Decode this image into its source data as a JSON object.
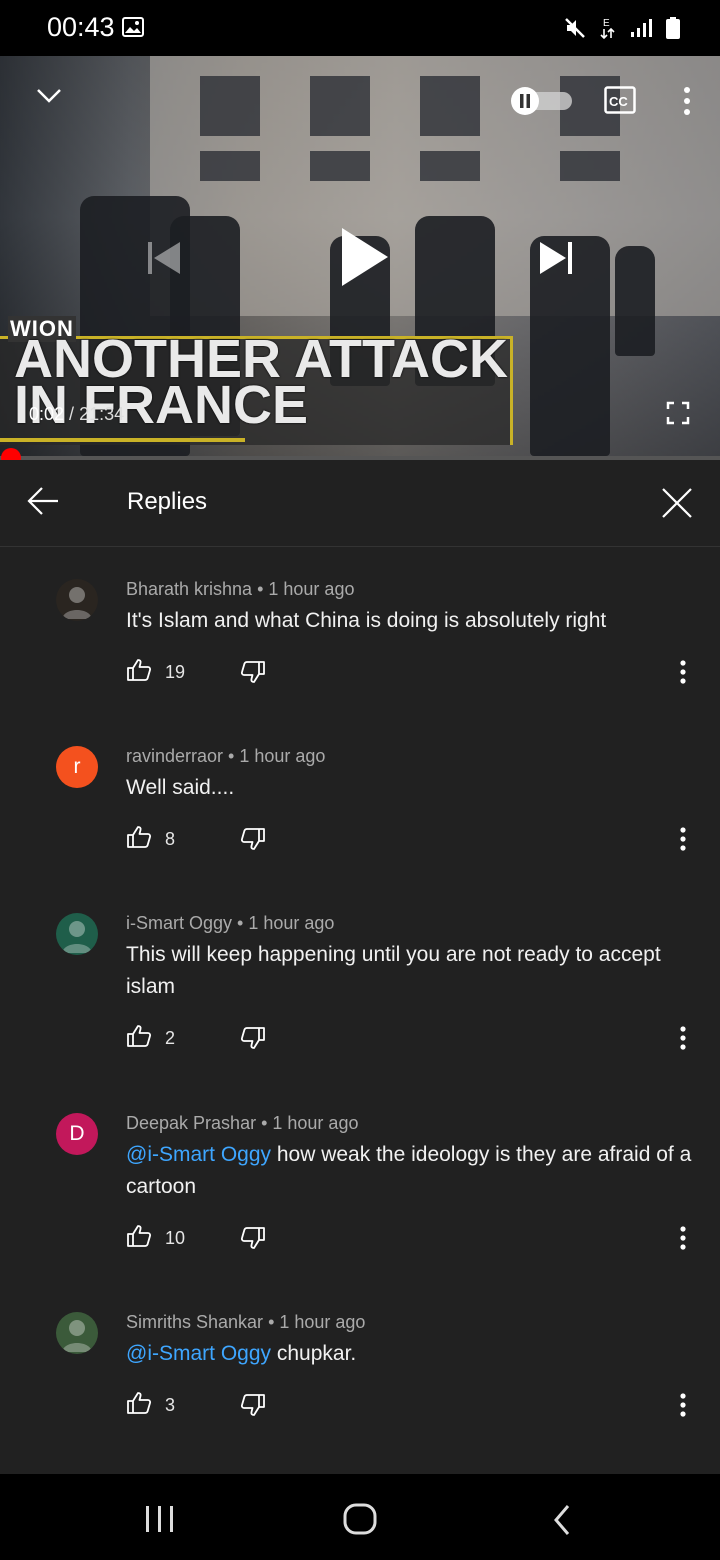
{
  "status_bar": {
    "time": "00:43"
  },
  "player": {
    "channel_logo": "WION",
    "headline_line1": "ANOTHER ATTACK",
    "headline_line2": "IN FRANCE",
    "current_time": "0:02",
    "separator": " / ",
    "duration": "21:34",
    "progress_fraction": 0.0015
  },
  "replies": {
    "title": "Replies",
    "comments": [
      {
        "author": "Bharath krishna",
        "age": "1 hour ago",
        "mention": "",
        "text": "It's Islam and what China is doing is absolutely right",
        "likes": "19",
        "avatar_letter": "",
        "avatar_color": "#2a2520"
      },
      {
        "author": "ravinderraor",
        "age": "1 hour ago",
        "mention": "",
        "text": "Well said....",
        "likes": "8",
        "avatar_letter": "r",
        "avatar_color": "#f4511e"
      },
      {
        "author": "i-Smart Oggy",
        "age": "1 hour ago",
        "mention": "",
        "text": "This will keep happening until you are not ready to accept islam",
        "likes": "2",
        "avatar_letter": "",
        "avatar_color": "#1f5e4a"
      },
      {
        "author": "Deepak Prashar",
        "age": "1 hour ago",
        "mention": "@i-Smart Oggy",
        "text": " how weak the ideology is they are afraid of a cartoon",
        "likes": "10",
        "avatar_letter": "D",
        "avatar_color": "#c2185b"
      },
      {
        "author": "Simriths Shankar",
        "age": "1 hour ago",
        "mention": "@i-Smart Oggy",
        "text": " chupkar.",
        "likes": "3",
        "avatar_letter": "",
        "avatar_color": "#3b5a3a"
      }
    ]
  }
}
